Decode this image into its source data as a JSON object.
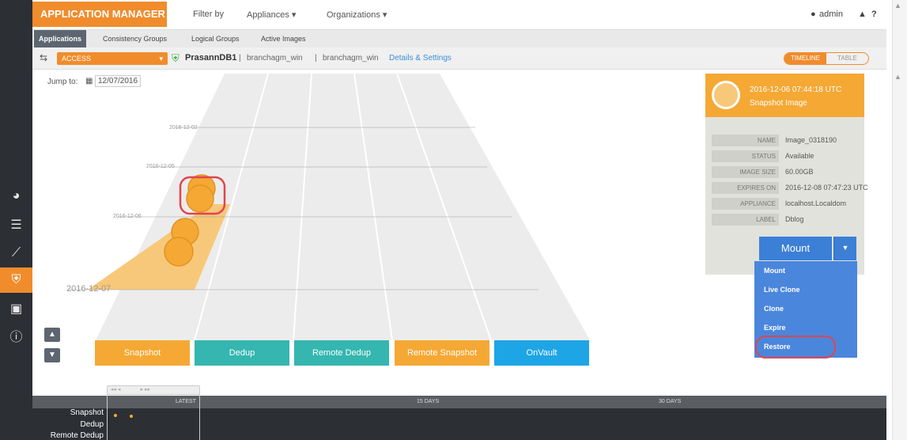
{
  "app": {
    "brand": "APPLICATION MANAGER",
    "filter_by": "Filter by",
    "filter_appliances": "Appliances ▾",
    "filter_organizations": "Organizations ▾",
    "user": "admin"
  },
  "subtabs": [
    "Applications",
    "Consistency Groups",
    "Logical Groups",
    "Active Images"
  ],
  "appbar": {
    "access": "ACCESS",
    "app_name": "PrasannDB1",
    "crumb1": "branchagm_win",
    "crumb2": "branchagm_win",
    "details": "Details & Settings",
    "view_timeline": "TIMELINE",
    "view_table": "TABLE"
  },
  "jump": {
    "label": "Jump to:",
    "date": "12/07/2016"
  },
  "dates": [
    "2016-12-02",
    "2016-12-05",
    "2016-12-06",
    "2016-12-07"
  ],
  "lanes": [
    {
      "label": "Snapshot",
      "color": "#f5a834"
    },
    {
      "label": "Dedup",
      "color": "#35b6b0"
    },
    {
      "label": "Remote Dedup",
      "color": "#35b6b0"
    },
    {
      "label": "Remote Snapshot",
      "color": "#f5a834"
    },
    {
      "label": "OnVault",
      "color": "#1ea5e6"
    }
  ],
  "panel": {
    "timestamp": "2016-12-06 07:44:18 UTC",
    "type": "Snapshot Image",
    "fields": [
      {
        "key": "NAME",
        "value": "Image_0318190"
      },
      {
        "key": "STATUS",
        "value": "Available"
      },
      {
        "key": "IMAGE SIZE",
        "value": "60.00GB"
      },
      {
        "key": "EXPIRES ON",
        "value": "2016-12-08 07:47:23 UTC"
      },
      {
        "key": "APPLIANCE",
        "value": "localhost.Localdom"
      },
      {
        "key": "LABEL",
        "value": "Dblog"
      }
    ],
    "mount_label": "Mount",
    "menu": [
      "Mount",
      "Live Clone",
      "Clone",
      "Expire",
      "Restore"
    ]
  },
  "timeline": {
    "marks": [
      "LATEST",
      "15 DAYS",
      "30 DAYS"
    ],
    "rows": [
      "Snapshot",
      "Dedup",
      "Remote Dedup"
    ]
  },
  "colors": {
    "accent": "#f08c2c",
    "blue": "#3b7fd6",
    "teal": "#35b6b0",
    "highlight": "#e0454f"
  }
}
